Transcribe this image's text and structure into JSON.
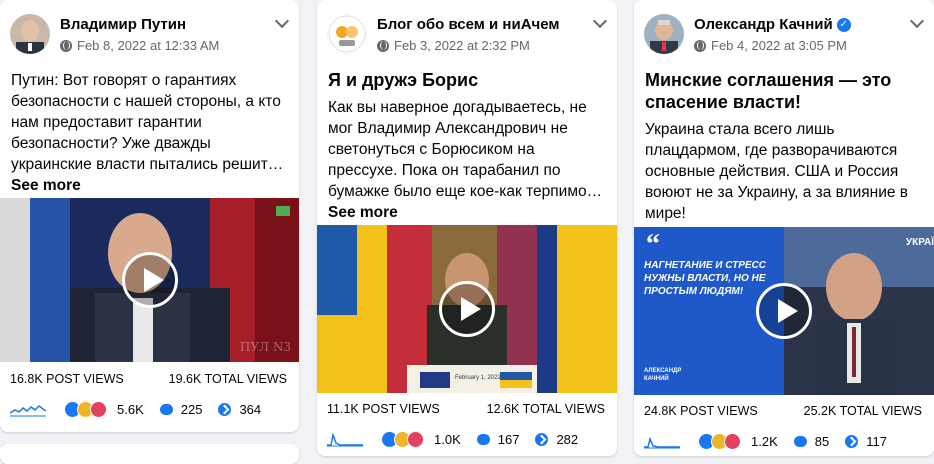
{
  "posts": [
    {
      "author": "Владимир Путин",
      "date": "Feb 8, 2022 at 12:33 AM",
      "text": "Путин: Вот говорят о гарантиях безопасности с нашей стороны, а кто нам предоставит гарантии безопасности? Уже дважды украинские власти пытались решит…",
      "see_more": "See more",
      "video_overlay": "ПУЛ N3",
      "post_views": "16.8K POST VIEWS",
      "total_views": "19.6K TOTAL VIEWS",
      "reactions": "5.6K",
      "comments": "225",
      "shares": "364"
    },
    {
      "author": "Блог обо всем и ниАчем",
      "date": "Feb 3, 2022 at 2:32 PM",
      "headline": "Я и дружэ Борис",
      "text": "Как вы наверное догадываетесь, не мог Владимир Александрович не светонуться с Борюсиком на прессухе. Пока он тарабанил по бумажке было еще кое-как терпимо…",
      "see_more": "See more",
      "podium_caption": "February 1, 2022",
      "post_views": "11.1K POST VIEWS",
      "total_views": "12.6K TOTAL VIEWS",
      "reactions": "1.0K",
      "comments": "167",
      "shares": "282"
    },
    {
      "author": "Олександр Качний",
      "verified_icon": "verified-badge-icon",
      "date": "Feb 4, 2022 at 3:05 PM",
      "headline": "Минские соглашения — это спасение власти!",
      "text": "Украина стала всего лишь плацдармом, где разворачиваются основные действия. США и Россия воюют не за Украину, а за влияние в мире!",
      "video_quote": "НАГНЕТАНИЕ И СТРЕСС НУЖНЫ ВЛАСТИ, НО НЕ ПРОСТЫМ ЛЮДЯМ!",
      "video_caption": "АЛЕКСАНДР КАЧНИЙ",
      "video_channel": "УКРАЇ",
      "post_views": "24.8K POST VIEWS",
      "total_views": "25.2K TOTAL VIEWS",
      "reactions": "1.2K",
      "comments": "85",
      "shares": "117"
    }
  ],
  "colors": {
    "brand": "#1877f2",
    "muted": "#65676b",
    "background": "#f0f2f5"
  }
}
